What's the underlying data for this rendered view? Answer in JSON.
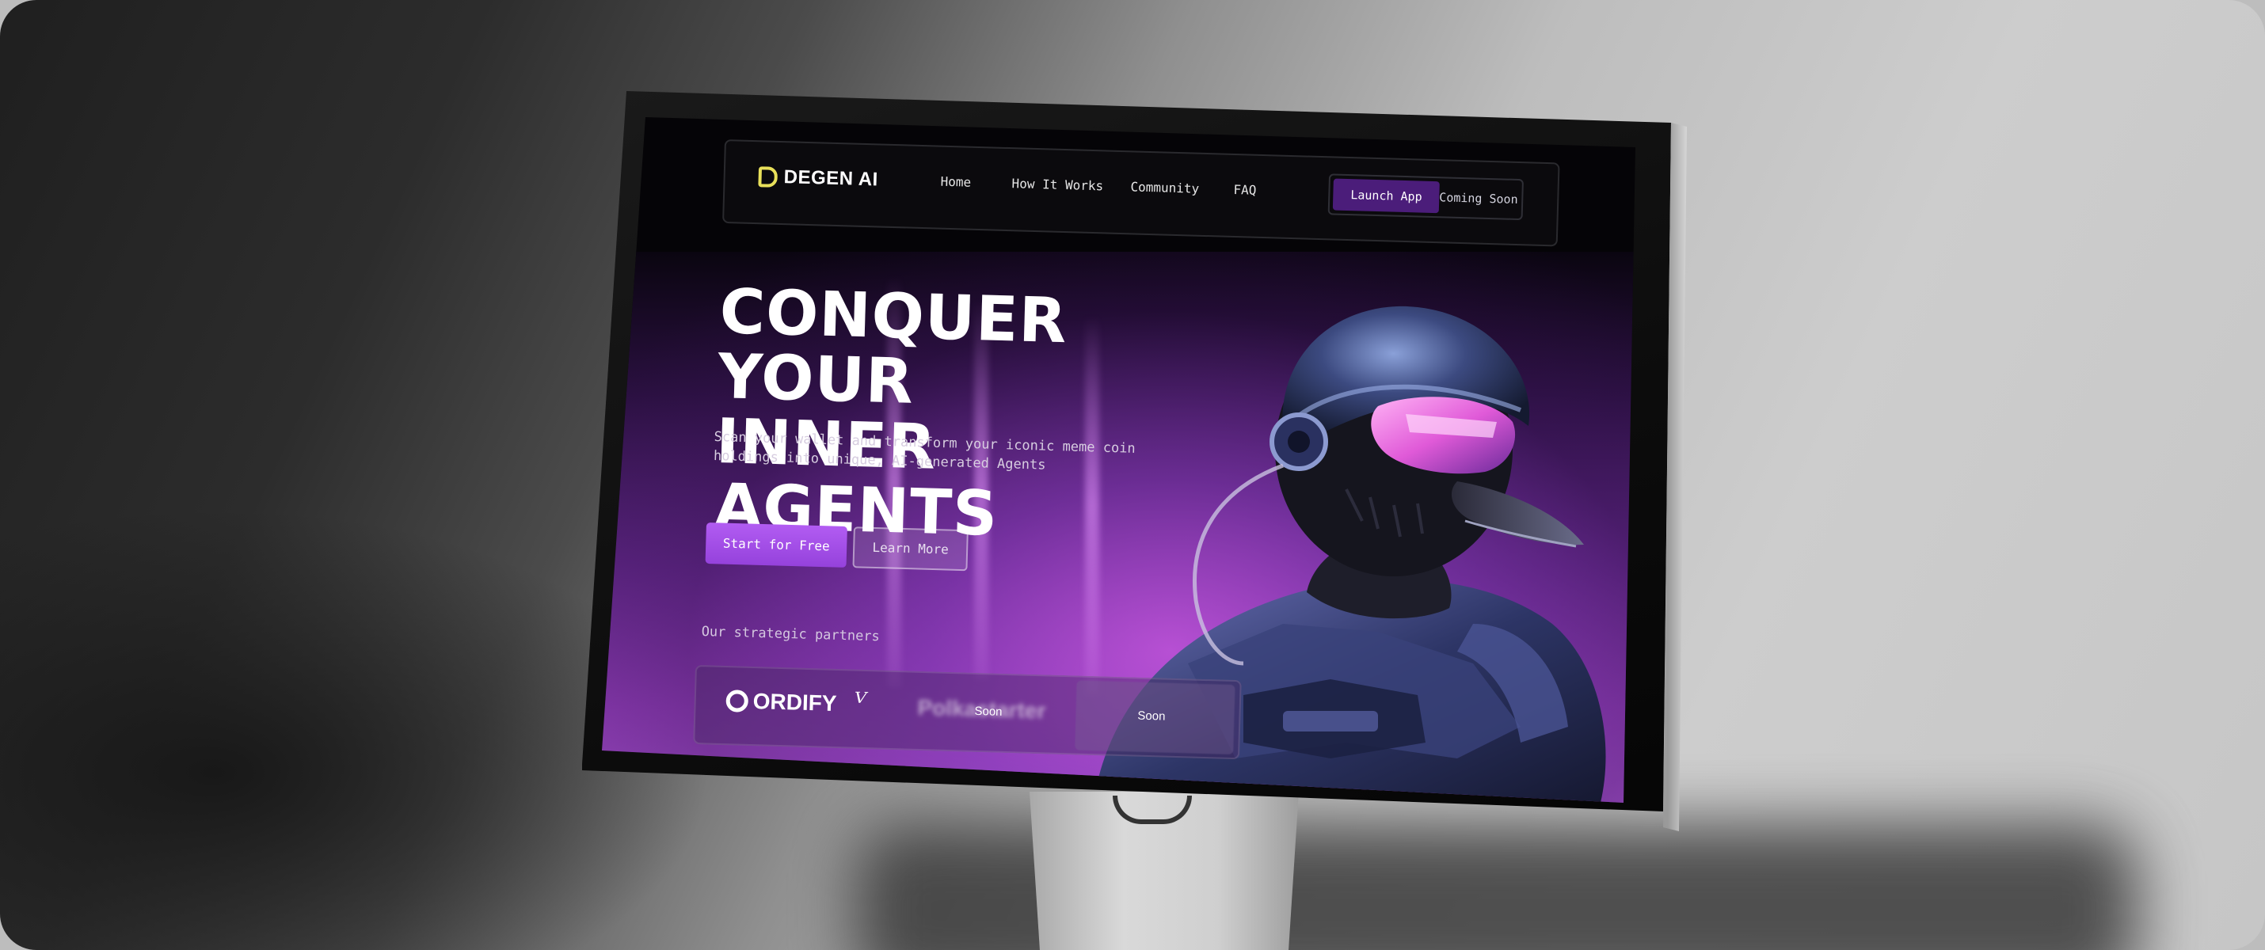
{
  "brand": {
    "name": "DEGEN AI",
    "accent": "#e8e05a"
  },
  "nav": {
    "links": [
      "Home",
      "How It Works",
      "Community",
      "FAQ"
    ],
    "launch_label": "Launch App",
    "soon_label": "Coming Soon"
  },
  "hero": {
    "title_line1": "CONQUER YOUR",
    "title_line2": "INNER AGENTS",
    "subtitle": "Scan your wallet and transform your iconic meme coin holdings into unique, AI-generated Agents",
    "primary_cta": "Start for Free",
    "secondary_cta": "Learn More",
    "accent": "#9f4ce6"
  },
  "partners": {
    "label": "Our strategic partners",
    "items": [
      {
        "name": "ORDIFY",
        "icon": "ordify-logo"
      },
      {
        "name": "",
        "icon": "partner-glyph-logo"
      },
      {
        "name": "Polkastarter",
        "status": "Soon"
      },
      {
        "name": "",
        "status": "Soon"
      }
    ]
  }
}
